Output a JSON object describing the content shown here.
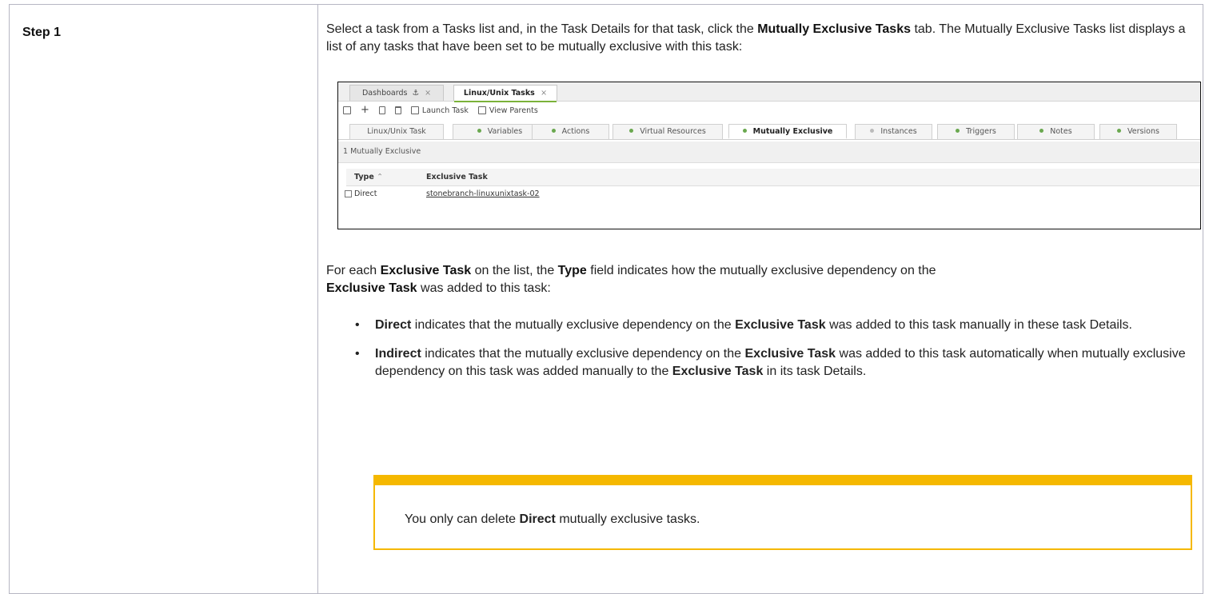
{
  "step": {
    "label": "Step 1"
  },
  "intro": {
    "t1": "Select a task from a Tasks list and, in the Task Details for that task, click the ",
    "b1": "Mutually Exclusive Tasks",
    "t2": " tab. The Mutually Exclusive Tasks list displays a list of any tasks that have been set to be mutually exclusive with this task:"
  },
  "screenshot": {
    "doc_tabs": [
      {
        "label": "Dashboards",
        "pin": "⚓",
        "close": "×"
      },
      {
        "label": "Linux/Unix Tasks",
        "close": "×"
      }
    ],
    "toolbar": {
      "launch_task": "Launch Task",
      "view_parents": "View Parents"
    },
    "detail_tabs": [
      "Linux/Unix Task",
      "Variables",
      "Actions",
      "Virtual Resources",
      "Mutually Exclusive",
      "Instances",
      "Triggers",
      "Notes",
      "Versions"
    ],
    "panel_title": "1 Mutually Exclusive",
    "columns": {
      "type": "Type",
      "exclusive": "Exclusive Task"
    },
    "rows": [
      {
        "type": "Direct",
        "task": "stonebranch-linuxunixtask-02"
      }
    ]
  },
  "para2": {
    "t1": "For each ",
    "b1": "Exclusive Task",
    "t2": " on the list, the ",
    "b2": "Type",
    "t3": " field indicates how the mutually exclusive dependency on the ",
    "b3": "Exclusive Task",
    "t4": " was added to this task:"
  },
  "bullets": [
    {
      "b1": "Direct",
      "t1": " indicates that the mutually exclusive dependency on the ",
      "b2": "Exclusive Task",
      "t2": " was added to this task manually in these task Details."
    },
    {
      "b1": "Indirect",
      "t1": " indicates that the mutually exclusive dependency on the ",
      "b2": "Exclusive Task",
      "t2": " was added to this task automatically when mutually exclusive dependency on this task was added manually to the ",
      "b3": "Exclusive Task",
      "t3": " in its task Details."
    }
  ],
  "note": {
    "t1": "You only can delete ",
    "b1": "Direct",
    "t2": " mutually exclusive tasks."
  },
  "colors": {
    "note_border": "#f5b800",
    "status_dot": "#6aa84f",
    "table_border": "#b6b6c3"
  }
}
